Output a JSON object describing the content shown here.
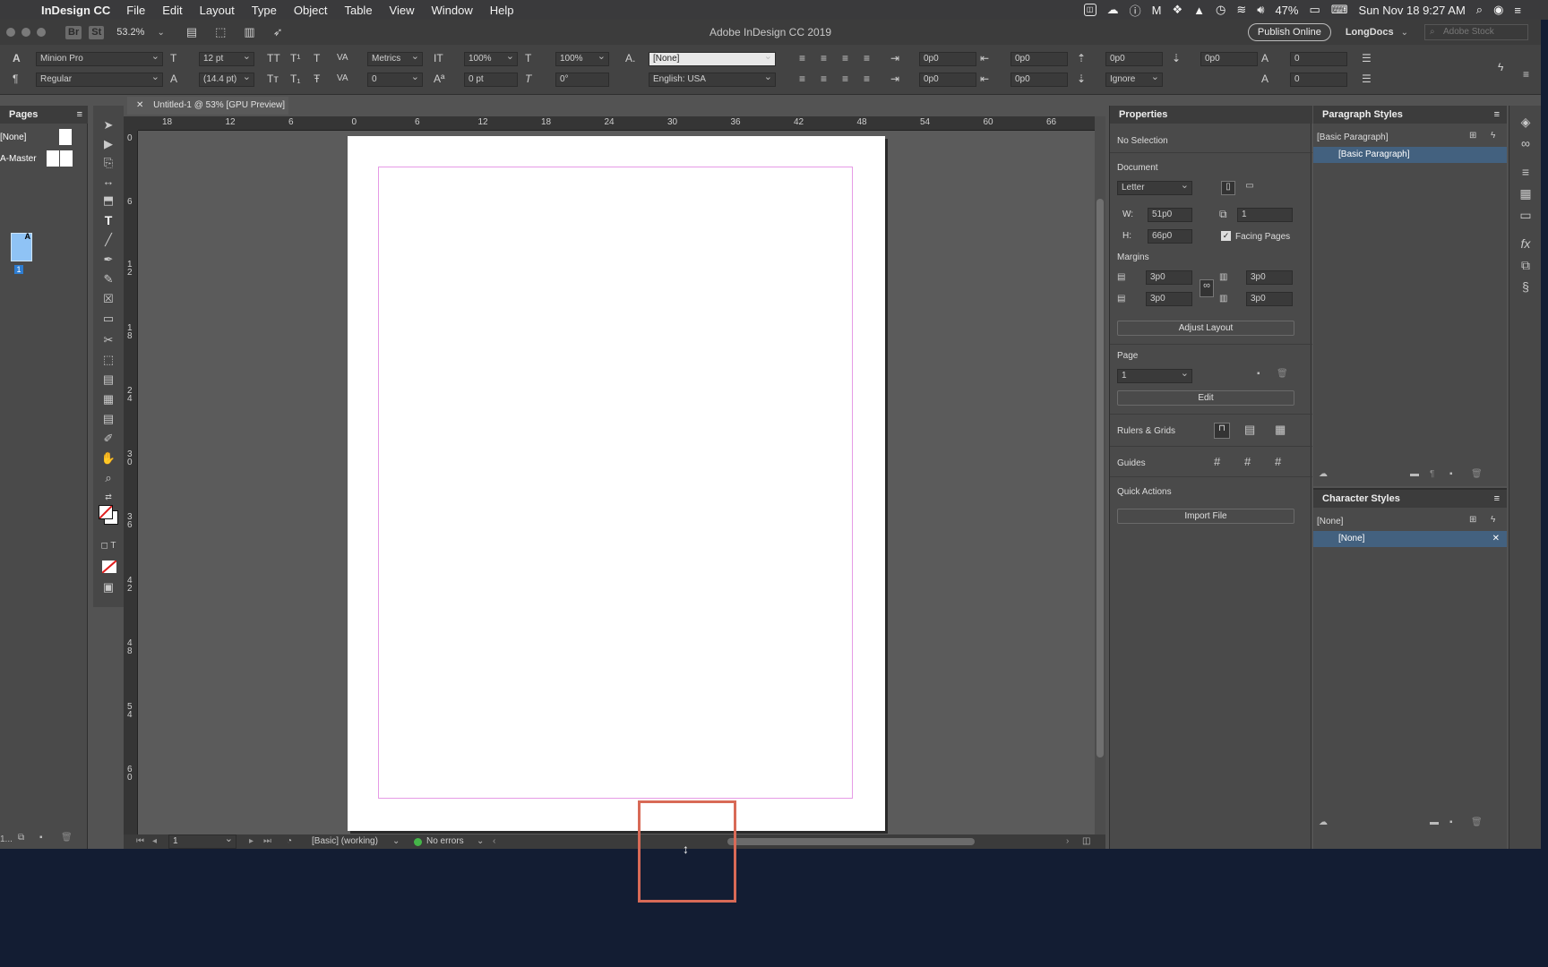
{
  "menubar": {
    "app_name": "InDesign CC",
    "items": [
      "File",
      "Edit",
      "Layout",
      "Type",
      "Object",
      "Table",
      "View",
      "Window",
      "Help"
    ],
    "battery": "47%",
    "datetime": "Sun Nov 18  9:27 AM"
  },
  "appbar": {
    "bridge": "Br",
    "stock": "St",
    "zoom": "53.2%",
    "title": "Adobe InDesign CC 2019",
    "publish": "Publish Online",
    "workspace": "LongDocs",
    "search_placeholder": "Adobe Stock"
  },
  "control": {
    "font": "Minion Pro",
    "style": "Regular",
    "size": "12 pt",
    "leading": "(14.4 pt)",
    "kerning": "Metrics",
    "tracking": "0",
    "vscale": "100%",
    "hscale": "100%",
    "baseline": "0 pt",
    "skew": "0°",
    "char_style": "[None]",
    "language": "English: USA",
    "indent_left": "0p0",
    "indent_first": "0p0",
    "indent_right": "0p0",
    "indent_last": "0p0",
    "space_before": "0p0",
    "space_after": "0p0",
    "align_grid": "Ignore",
    "dropcap_lines": "0",
    "dropcap_chars": "0"
  },
  "pages_panel": {
    "title": "Pages",
    "none_label": "[None]",
    "master_label": "A-Master",
    "page_letter": "A",
    "page_number": "1",
    "footer": "1..."
  },
  "document": {
    "tab_title": "Untitled-1 @ 53% [GPU Preview]",
    "h_ruler": [
      "18",
      "12",
      "6",
      "0",
      "6",
      "12",
      "18",
      "24",
      "30",
      "36",
      "42",
      "48",
      "54",
      "60",
      "66"
    ],
    "v_ruler": [
      "0",
      "6",
      "1\n2",
      "1\n8",
      "2\n4",
      "3\n0",
      "3\n6",
      "4\n2",
      "4\n8",
      "5\n4",
      "6\n0"
    ]
  },
  "statusbar": {
    "page": "1",
    "profile": "[Basic] (working)",
    "errors": "No errors"
  },
  "properties": {
    "title": "Properties",
    "selection": "No Selection",
    "document_label": "Document",
    "preset": "Letter",
    "w_label": "W:",
    "width": "51p0",
    "h_label": "H:",
    "height": "66p0",
    "pages": "1",
    "facing_pages": "Facing Pages",
    "margins_label": "Margins",
    "margin_top": "3p0",
    "margin_bottom": "3p0",
    "margin_inside": "3p0",
    "margin_outside": "3p0",
    "adjust_layout": "Adjust Layout",
    "page_label": "Page",
    "page_value": "1",
    "edit": "Edit",
    "rulers_grids": "Rulers & Grids",
    "guides": "Guides",
    "quick_actions": "Quick Actions",
    "import_file": "Import File"
  },
  "paragraph_styles": {
    "title": "Paragraph Styles",
    "current": "[Basic Paragraph]",
    "selected": "[Basic Paragraph]"
  },
  "character_styles": {
    "title": "Character Styles",
    "current": "[None]",
    "selected": "[None]"
  },
  "colors": {
    "highlight": "#d86a57",
    "margin_guide": "#e69be6",
    "selection": "#43617f",
    "desktop": "#131d33"
  }
}
